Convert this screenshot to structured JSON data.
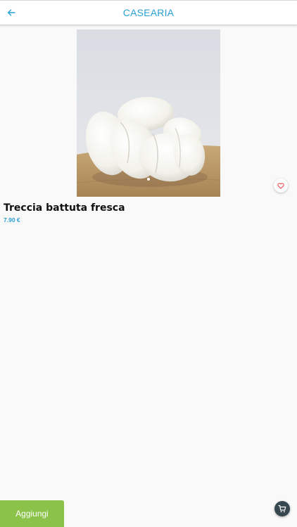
{
  "header": {
    "title": "CASEARIA",
    "back_icon": "arrow-left-icon"
  },
  "product": {
    "image_icon": "braided-cheese-photo",
    "name": "Treccia battuta fresca",
    "price": "7.90 €",
    "favorite_icon": "heart-outline-icon"
  },
  "actions": {
    "add_label": "Aggiungi",
    "cart_icon": "cart-icon"
  },
  "colors": {
    "accent": "#2a9fd6",
    "add_button": "#8bc34a",
    "cart_button": "#37474f",
    "favorite": "#e53935"
  }
}
